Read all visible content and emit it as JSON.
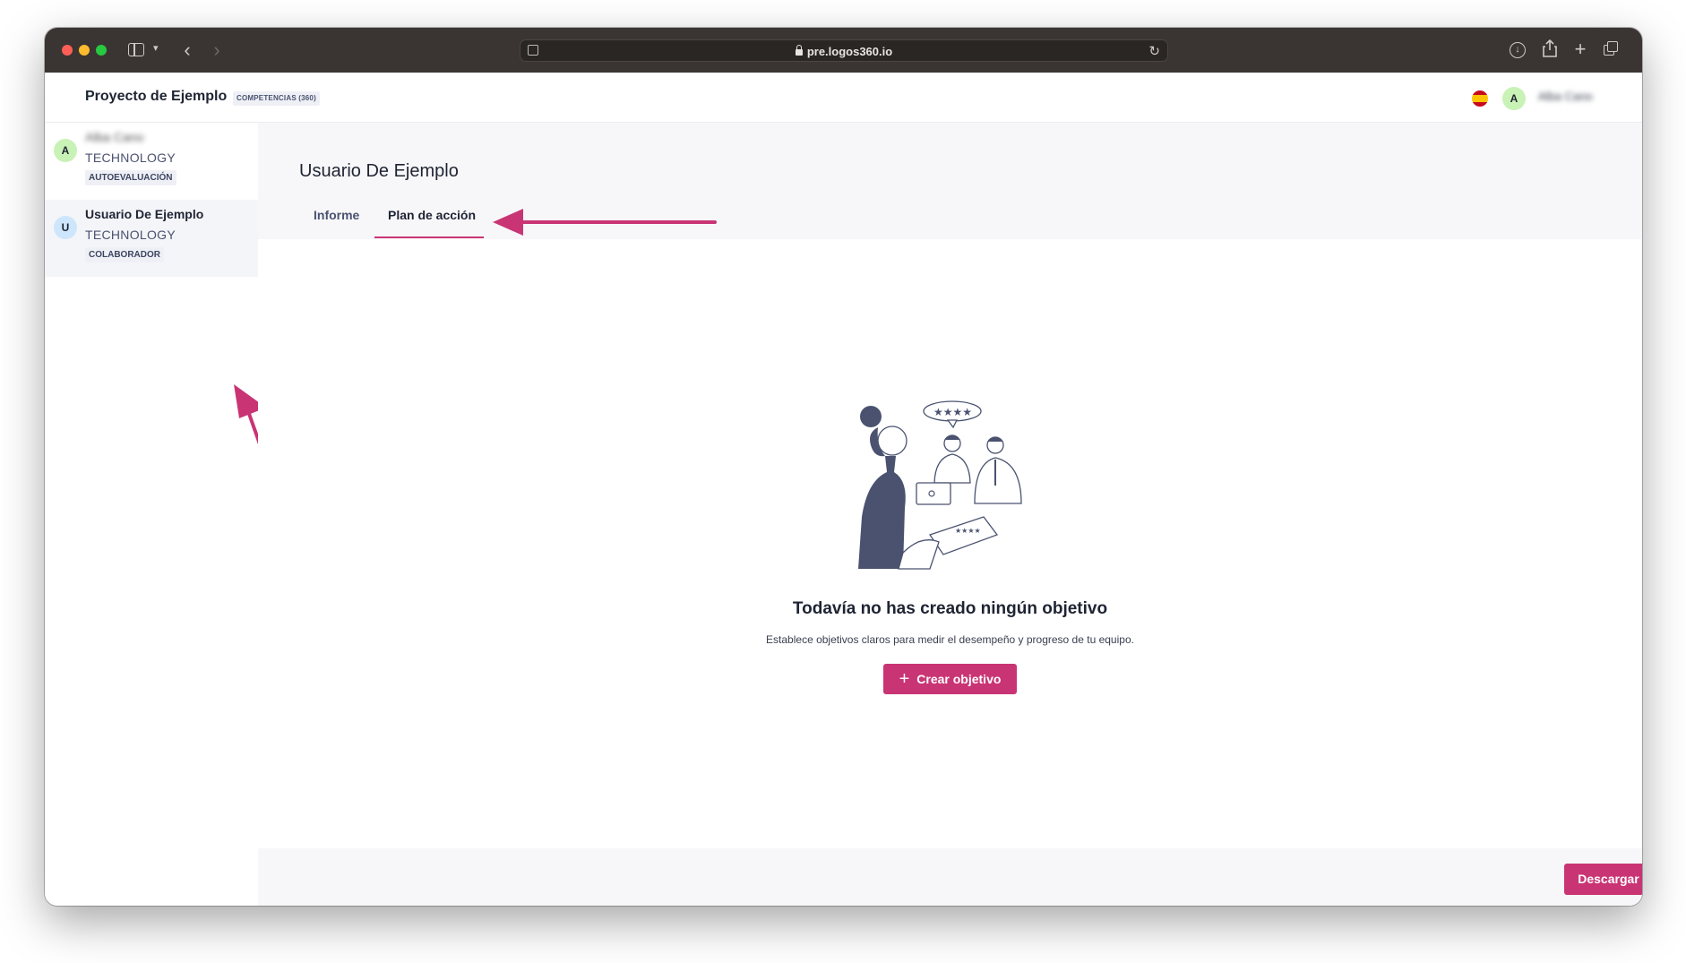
{
  "browser": {
    "url": "pre.logos360.io"
  },
  "header": {
    "project_title": "Proyecto de Ejemplo",
    "project_badge": "COMPETENCIAS (360)",
    "avatar_initial": "A",
    "username": "Alba Cano"
  },
  "sidebar": {
    "people": [
      {
        "initial": "A",
        "name": "Alba Cano",
        "department": "TECHNOLOGY",
        "role": "AUTOEVALUACIÓN",
        "avatar_color": "#c9f2b6"
      },
      {
        "initial": "U",
        "name": "Usuario De Ejemplo",
        "department": "TECHNOLOGY",
        "role": "COLABORADOR",
        "avatar_color": "#cde6fb"
      }
    ]
  },
  "main": {
    "title": "Usuario De Ejemplo",
    "tabs": [
      {
        "label": "Informe",
        "active": false
      },
      {
        "label": "Plan de acción",
        "active": true
      }
    ],
    "empty_state": {
      "title": "Todavía no has creado ningún objetivo",
      "description": "Establece objetivos claros para medir el desempeño y progreso de tu equipo.",
      "button_label": "Crear objetivo"
    },
    "download_label": "Descargar"
  },
  "colors": {
    "accent": "#c93474",
    "annotation_arrow": "#c93474"
  }
}
